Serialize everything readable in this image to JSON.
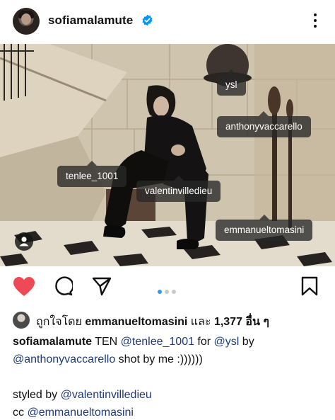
{
  "header": {
    "username": "sofiamalamute",
    "verified_icon": "verified-badge-icon",
    "more_icon": "more-options-icon"
  },
  "photo": {
    "tags": [
      {
        "label": "ysl"
      },
      {
        "label": "anthonyvaccarello"
      },
      {
        "label": "tenlee_1001"
      },
      {
        "label": "valentinvilledieu"
      },
      {
        "label": "emmanueltomasini"
      }
    ],
    "user_tags_icon": "person-icon"
  },
  "actions": {
    "like_icon": "heart-icon",
    "comment_icon": "comment-icon",
    "share_icon": "send-icon",
    "save_icon": "bookmark-icon",
    "carousel_total": 3,
    "carousel_current": 1,
    "colors": {
      "like": "#ed4956",
      "carousel_active": "#3897f0"
    }
  },
  "likes": {
    "prefix": "ถูกใจโดย",
    "user": "emmanueltomasini",
    "middle": "และ",
    "count_text": "1,377 อื่น ๆ"
  },
  "caption": {
    "user": "sofiamalamute",
    "line1_text1": " TEN ",
    "mention_tenlee": "@tenlee_1001",
    "line1_text2": " for ",
    "mention_ysl": "@ysl",
    "line1_text3": " by",
    "mention_anthony": "@anthonyvaccarello",
    "line2_text": " shot by me :))))))",
    "styled_prefix": "styled by ",
    "mention_valentin": "@valentinvilledieu",
    "cc_prefix": "cc ",
    "mention_emmanuel": "@emmanueltomasini"
  }
}
